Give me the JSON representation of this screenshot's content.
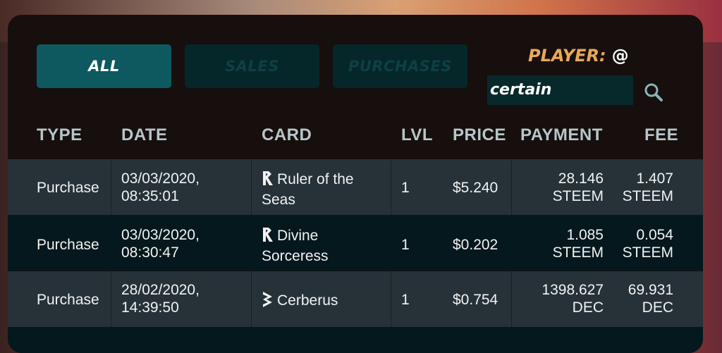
{
  "tabs": {
    "all": "ALL",
    "sales": "SALES",
    "purchases": "PURCHASES"
  },
  "player": {
    "label": "PLAYER:",
    "at": "@",
    "value": "certain"
  },
  "columns": [
    "TYPE",
    "DATE",
    "CARD",
    "LVL",
    "PRICE",
    "PAYMENT",
    "FEE"
  ],
  "rows": [
    {
      "type": "Purchase",
      "date_l1": "03/03/2020,",
      "date_l2": "08:35:01",
      "card_l1": "Ruler of the",
      "card_l2": "Seas",
      "card_icon": "edition-r-icon",
      "lvl": "1",
      "price": "$5.240",
      "pay_l1": "28.146",
      "pay_l2": "STEEM",
      "fee_l1": "1.407",
      "fee_l2": "STEEM"
    },
    {
      "type": "Purchase",
      "date_l1": "03/03/2020,",
      "date_l2": "08:30:47",
      "card_l1": "Divine",
      "card_l2": "Sorceress",
      "card_icon": "edition-r-icon",
      "lvl": "1",
      "price": "$0.202",
      "pay_l1": "1.085",
      "pay_l2": "STEEM",
      "fee_l1": "0.054",
      "fee_l2": "STEEM"
    },
    {
      "type": "Purchase",
      "date_l1": "28/02/2020,",
      "date_l2": "14:39:50",
      "card_l1": "Cerberus",
      "card_l2": "",
      "card_icon": "edition-b-icon",
      "lvl": "1",
      "price": "$0.754",
      "pay_l1": "1398.627",
      "pay_l2": "DEC",
      "fee_l1": "69.931",
      "fee_l2": "DEC"
    }
  ],
  "colors": {
    "tab_active": "#0e5960",
    "tab_inactive": "#05272a",
    "player_label": "#e8a85a",
    "row_odd": "#263238",
    "row_even": "#05181d"
  }
}
